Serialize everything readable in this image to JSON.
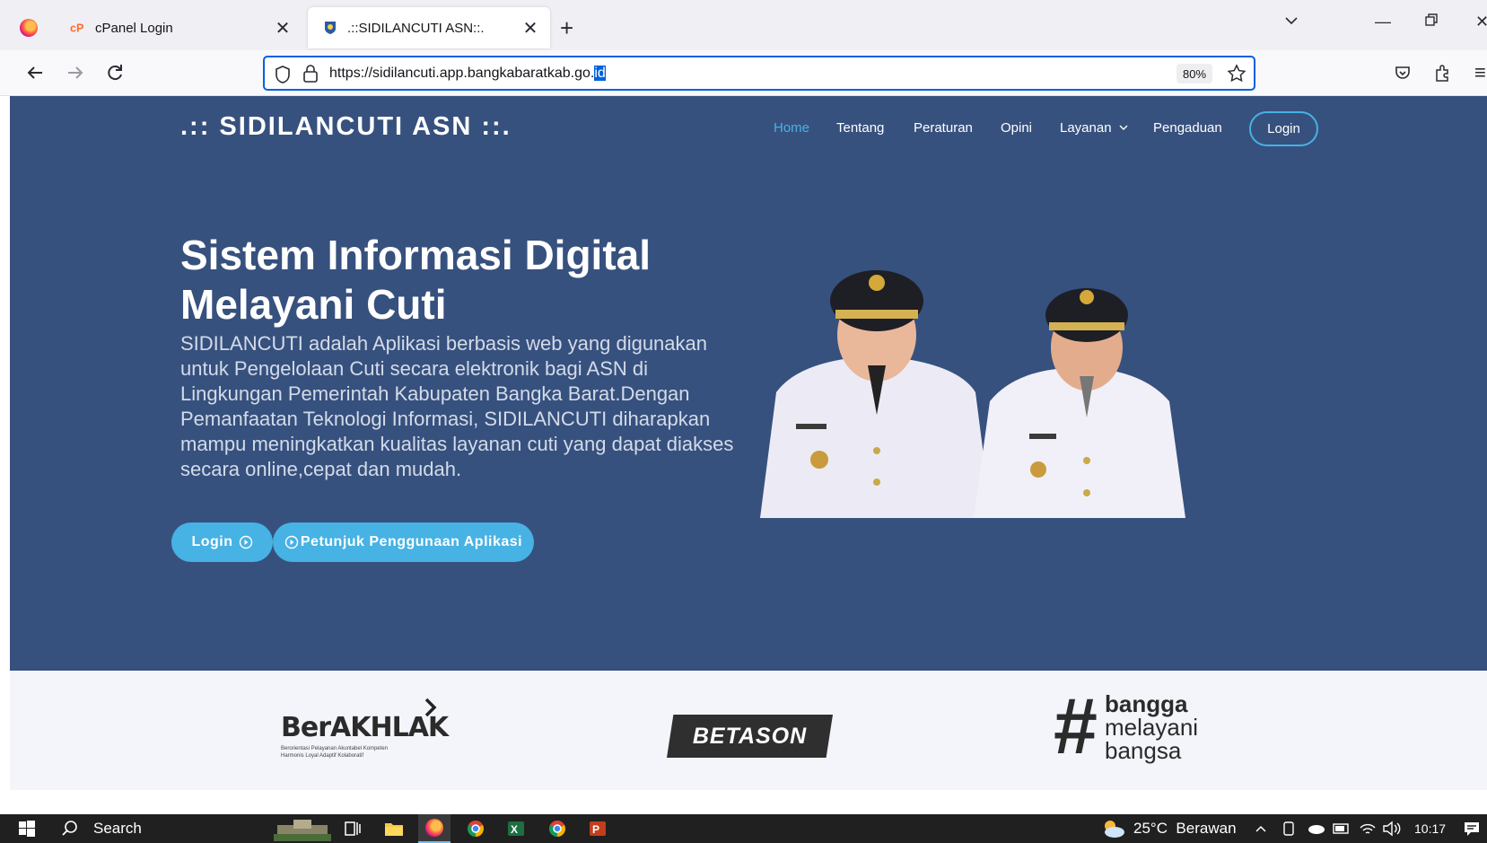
{
  "browser": {
    "tabs": [
      {
        "title": "cPanel Login",
        "active": false
      },
      {
        "title": ".::SIDILANCUTI ASN::.",
        "active": true
      }
    ],
    "url_main": "https://sidilancuti.app.bangkabaratkab.go.",
    "url_selected": "id",
    "zoom": "80%"
  },
  "site": {
    "brand": ".:: SIDILANCUTI ASN ::.",
    "menu": [
      "Home",
      "Tentang",
      "Peraturan",
      "Opini",
      "Layanan",
      "Pengaduan"
    ],
    "login_label": "Login"
  },
  "hero": {
    "title_line1": "Sistem Informasi Digital",
    "title_line2": "Melayani Cuti",
    "description": "SIDILANCUTI adalah Aplikasi berbasis web yang digunakan untuk Pengelolaan Cuti secara elektronik bagi ASN di Lingkungan Pemerintah Kabupaten Bangka Barat.Dengan Pemanfaatan Teknologi Informasi, SIDILANCUTI diharapkan mampu meningkatkan kualitas layanan cuti yang dapat diakses secara online,cepat dan mudah.",
    "btn_login": "Login",
    "btn_guide": "Petunjuk Penggunaan Aplikasi"
  },
  "logos": {
    "berakhlak": "BerAKHLAK",
    "berakhlak_sub1": "Berorientasi Pelayanan Akuntabel Kompeten",
    "berakhlak_sub2": "Harmonis Loyal Adaptif Kolaboratif",
    "betason": "BETASON",
    "bangga1": "bangga",
    "bangga2": "melayani",
    "bangga3": "bangsa"
  },
  "taskbar": {
    "search": "Search",
    "weather": "25°C  Berawan",
    "time": "10:17"
  }
}
